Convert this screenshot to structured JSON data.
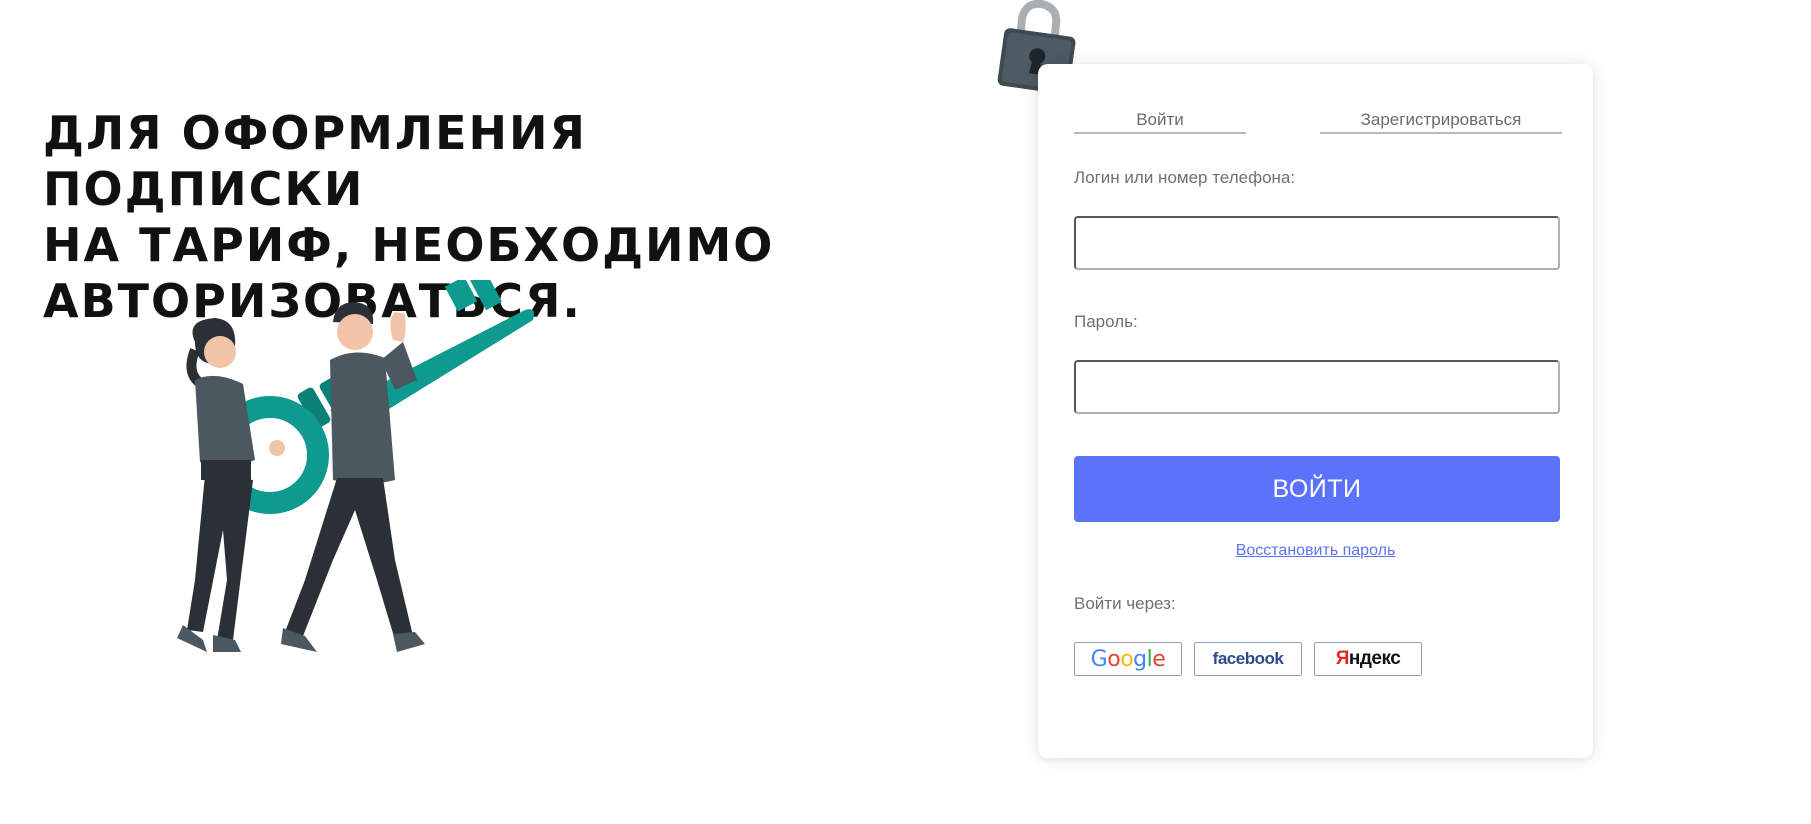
{
  "headline": "Для оформления подписки\nна тариф, необходимо\nавторизоваться.",
  "tabs": {
    "login": "Войти",
    "register": "Зарегистрироваться"
  },
  "form": {
    "login_label": "Логин или номер телефона:",
    "login_value": "",
    "password_label": "Пароль:",
    "password_value": "",
    "submit_label": "ВОЙТИ",
    "restore_link": "Восстановить пароль",
    "social_label": "Войти через:"
  },
  "social": {
    "google": "Google",
    "facebook": "facebook",
    "yandex_first": "Я",
    "yandex_rest": "ндекс"
  },
  "colors": {
    "accent": "#5b72fb",
    "key": "#0f9a8f",
    "clothing": "#4c5860",
    "text": "#111111"
  },
  "icons": {
    "lock": "padlock-icon",
    "illustration": "people-carrying-key-illustration"
  }
}
